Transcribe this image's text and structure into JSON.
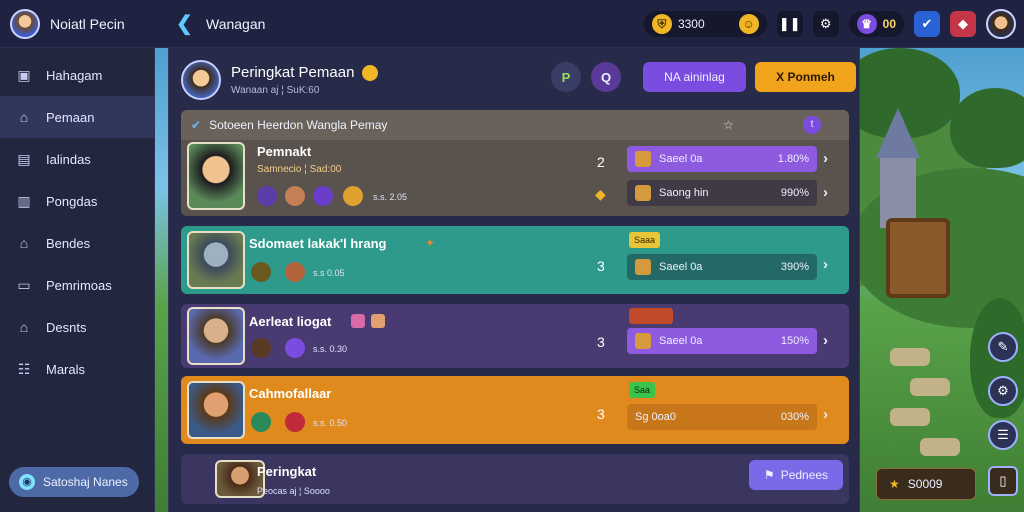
{
  "topbar": {
    "user_name": "Noiatl Pecin",
    "brand_title": "Wanagan",
    "gold_value": "3300",
    "hud_value": "00"
  },
  "sidebar": {
    "items": [
      {
        "label": "Hahagam",
        "icon": "menu-icon"
      },
      {
        "label": "Pemaan",
        "icon": "home-icon"
      },
      {
        "label": "Ialindas",
        "icon": "book-icon"
      },
      {
        "label": "Pongdas",
        "icon": "building-icon"
      },
      {
        "label": "Bendes",
        "icon": "home-icon"
      },
      {
        "label": "Pemrimoas",
        "icon": "window-icon"
      },
      {
        "label": "Desnts",
        "icon": "home-icon"
      },
      {
        "label": "Marals",
        "icon": "users-icon"
      }
    ],
    "bottom_button": "Satoshaj Nanes"
  },
  "panel": {
    "title": "Peringkat Pemaan",
    "subtitle": "Wanaan aj  ¦  SuK:60",
    "circle_btn_1": "P",
    "circle_btn_2": "Q",
    "purple_btn": "NA aininlag",
    "orange_btn": "X Ponmeh",
    "section_header": "Sotoeen Heerdon Wangla Pemay",
    "cards": [
      {
        "title": "Pemnakt",
        "sub": "Samnecio  ¦  Sad:00",
        "small": "s.s. 2.05",
        "rank": "2",
        "bars": [
          {
            "label": "Saeel 0a",
            "value": "1.80%"
          },
          {
            "label": "Saong hin",
            "value": "990%"
          }
        ]
      },
      {
        "title": "Sdomaet lakak'l hrang",
        "small": "s.s 0.05",
        "rank": "3",
        "tag": "Saaa",
        "bars": [
          {
            "label": "Saeel 0a",
            "value": "390%"
          }
        ]
      },
      {
        "title": "Aerleat liogat",
        "small": "s.s. 0.30",
        "rank": "3",
        "bars": [
          {
            "label": "Saeel 0a",
            "value": "150%"
          }
        ]
      },
      {
        "title": "Cahmofallaar",
        "small": "s.s. 0.50",
        "rank": "3",
        "tag": "Saa",
        "bars": [
          {
            "label": "Sg 0oa0",
            "value": "030%"
          }
        ]
      }
    ],
    "footer": {
      "title": "Peringkat",
      "sub": "Peocas aj  ¦  Soooo",
      "button": "Pednees"
    }
  },
  "world": {
    "bottom_value": "S0009"
  }
}
